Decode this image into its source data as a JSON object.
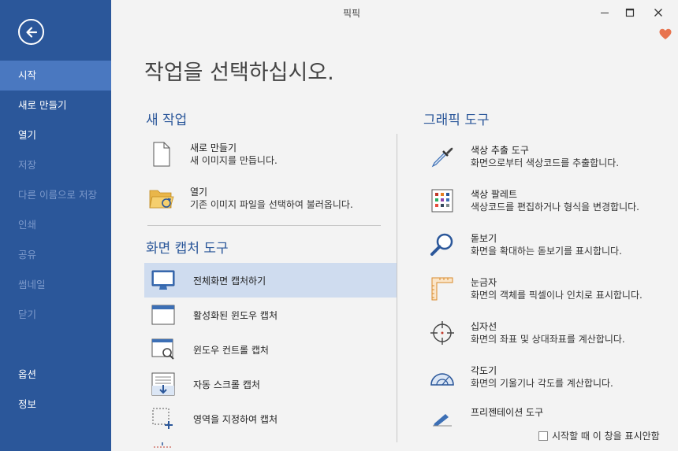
{
  "window": {
    "title": "픽픽"
  },
  "sidebar": {
    "items": [
      {
        "label": "시작"
      },
      {
        "label": "새로 만들기"
      },
      {
        "label": "열기"
      },
      {
        "label": "저장"
      },
      {
        "label": "다른 이름으로 저장"
      },
      {
        "label": "인쇄"
      },
      {
        "label": "공유"
      },
      {
        "label": "썸네일"
      },
      {
        "label": "닫기"
      }
    ],
    "bottom_items": [
      {
        "label": "옵션"
      },
      {
        "label": "정보"
      }
    ]
  },
  "main": {
    "page_title": "작업을 선택하십시오.",
    "new_task": {
      "title": "새 작업",
      "items": [
        {
          "title": "새로 만들기",
          "desc": "새 이미지를 만듭니다.",
          "icon": "new-document-icon"
        },
        {
          "title": "열기",
          "desc": "기존 이미지 파일을 선택하여 불러옵니다.",
          "icon": "open-folder-icon"
        }
      ]
    },
    "capture_tools": {
      "title": "화면 캡처 도구",
      "items": [
        {
          "label": "전체화면 캡처하기",
          "icon": "monitor-icon"
        },
        {
          "label": "활성화된 윈도우 캡처",
          "icon": "active-window-icon"
        },
        {
          "label": "윈도우 컨트롤 캡처",
          "icon": "window-control-icon"
        },
        {
          "label": "자동 스크롤 캡처",
          "icon": "scroll-capture-icon"
        },
        {
          "label": "영역을 지정하여 캡처",
          "icon": "region-capture-icon"
        }
      ]
    },
    "graphic_tools": {
      "title": "그래픽 도구",
      "items": [
        {
          "title": "색상 추출 도구",
          "desc": "화면으로부터 색상코드를 추출합니다.",
          "icon": "eyedropper-icon"
        },
        {
          "title": "색상 팔레트",
          "desc": "색상코드를 편집하거나 형식을 변경합니다.",
          "icon": "palette-icon"
        },
        {
          "title": "돋보기",
          "desc": "화면을 확대하는 돋보기를 표시합니다.",
          "icon": "magnifier-icon"
        },
        {
          "title": "눈금자",
          "desc": "화면의 객체를 픽셀이나 인치로 표시합니다.",
          "icon": "ruler-icon"
        },
        {
          "title": "십자선",
          "desc": "화면의 좌표 및 상대좌표를 계산합니다.",
          "icon": "crosshair-icon"
        },
        {
          "title": "각도기",
          "desc": "화면의 기울기나 각도를 계산합니다.",
          "icon": "protractor-icon"
        },
        {
          "title": "프리젠테이션 도구",
          "desc": "",
          "icon": "presentation-pen-icon"
        }
      ]
    },
    "footer": {
      "dont_show_label": "시작할 때 이 창을 표시안함",
      "checked": false
    }
  },
  "colors": {
    "sidebar": "#2b579a",
    "active": "#4a78c0",
    "accent": "#2b579a",
    "heart": "#e8744f",
    "selected_row": "#cfdcef"
  }
}
